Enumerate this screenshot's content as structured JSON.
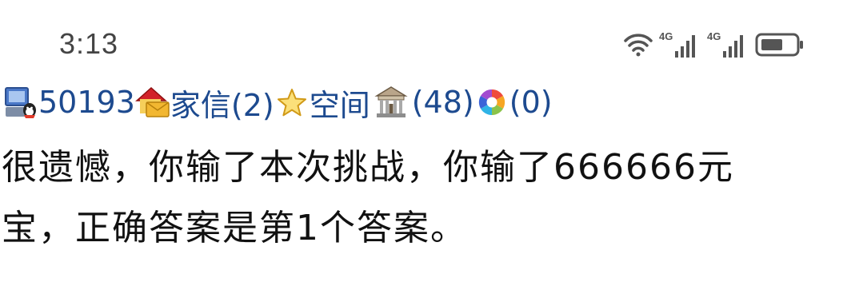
{
  "status_bar": {
    "time": "3:13",
    "icons": [
      "wifi-icon",
      "signal-4g-icon",
      "signal-4g-icon",
      "battery-icon"
    ],
    "network_label_1": "4G",
    "network_label_2": "4G"
  },
  "nav": {
    "user_id": "50193",
    "mail_label": "家信(2)",
    "space_label": "空间",
    "building_count": "(48)",
    "album_count": "(0)"
  },
  "message": {
    "text": "很遗憾，你输了本次挑战，你输了666666元宝，正确答案是第1个答案。"
  },
  "colors": {
    "link": "#1d4a8f",
    "text": "#111111",
    "status_text": "#444444"
  }
}
